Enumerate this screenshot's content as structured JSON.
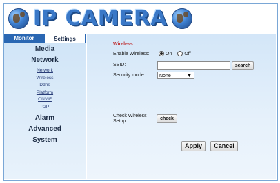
{
  "header": {
    "logo_text": "IP CAMERA"
  },
  "sidebar": {
    "tabs": [
      {
        "label": "Monitor"
      },
      {
        "label": "Settings"
      }
    ],
    "sections": [
      {
        "label": "Media"
      },
      {
        "label": "Network"
      },
      {
        "label": "Alarm"
      },
      {
        "label": "Advanced"
      },
      {
        "label": "System"
      }
    ],
    "network_items": [
      {
        "label": "Network"
      },
      {
        "label": "Wireless"
      },
      {
        "label": "Ddns"
      },
      {
        "label": "Platform"
      },
      {
        "label": "ONVIF"
      },
      {
        "label": "P2P"
      }
    ]
  },
  "wireless": {
    "title": "Wireless",
    "enable_label": "Enable Wireless:",
    "on_label": "On",
    "off_label": "Off",
    "enabled": true,
    "ssid_label": "SSID:",
    "ssid_value": "",
    "search_label": "search",
    "security_label": "Security mode:",
    "security_value": "None",
    "check_label_line1": "Check Wireless",
    "check_label_line2": "Setup:",
    "check_button": "check",
    "apply_button": "Apply",
    "cancel_button": "Cancel"
  },
  "colors": {
    "accent": "#2a67b3",
    "title_red": "#c0383b",
    "panel_bg": "#d3e6f8"
  }
}
